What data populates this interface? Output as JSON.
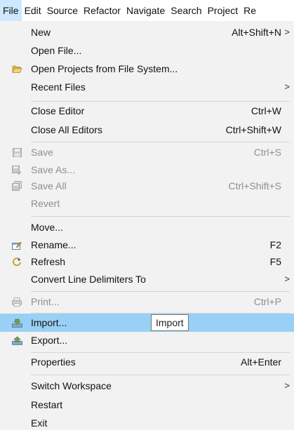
{
  "menubar": {
    "items": [
      "File",
      "Edit",
      "Source",
      "Refactor",
      "Navigate",
      "Search",
      "Project",
      "Re"
    ]
  },
  "menu": {
    "new": {
      "label": "New",
      "shortcut": "Alt+Shift+N",
      "submenu_arrow": ">"
    },
    "open_file": {
      "label": "Open File..."
    },
    "open_projects": {
      "label": "Open Projects from File System...",
      "icon": "folder-open-icon"
    },
    "recent_files": {
      "label": "Recent Files",
      "submenu_arrow": ">"
    },
    "close_editor": {
      "label": "Close Editor",
      "shortcut": "Ctrl+W"
    },
    "close_all_editors": {
      "label": "Close All Editors",
      "shortcut": "Ctrl+Shift+W"
    },
    "save": {
      "label": "Save",
      "shortcut": "Ctrl+S",
      "icon": "save-icon"
    },
    "save_as": {
      "label": "Save As...",
      "icon": "save-as-icon"
    },
    "save_all": {
      "label": "Save All",
      "shortcut": "Ctrl+Shift+S",
      "icon": "save-all-icon"
    },
    "revert": {
      "label": "Revert"
    },
    "move": {
      "label": "Move..."
    },
    "rename": {
      "label": "Rename...",
      "shortcut": "F2",
      "icon": "rename-icon"
    },
    "refresh": {
      "label": "Refresh",
      "shortcut": "F5",
      "icon": "refresh-icon"
    },
    "convert_line_delimiters": {
      "label": "Convert Line Delimiters To",
      "submenu_arrow": ">"
    },
    "print": {
      "label": "Print...",
      "shortcut": "Ctrl+P",
      "icon": "print-icon"
    },
    "import": {
      "label": "Import...",
      "icon": "import-icon"
    },
    "export": {
      "label": "Export...",
      "icon": "export-icon"
    },
    "properties": {
      "label": "Properties",
      "shortcut": "Alt+Enter"
    },
    "switch_workspace": {
      "label": "Switch Workspace",
      "submenu_arrow": ">"
    },
    "restart": {
      "label": "Restart"
    },
    "exit": {
      "label": "Exit"
    }
  },
  "tooltip": {
    "text": "Import"
  },
  "colors": {
    "menu_background": "#f2f2f2",
    "highlight": "#9ad0f5",
    "menubar_active": "#cde8ff",
    "disabled_text": "#8f8f8f",
    "separator": "#d4d4d4"
  }
}
